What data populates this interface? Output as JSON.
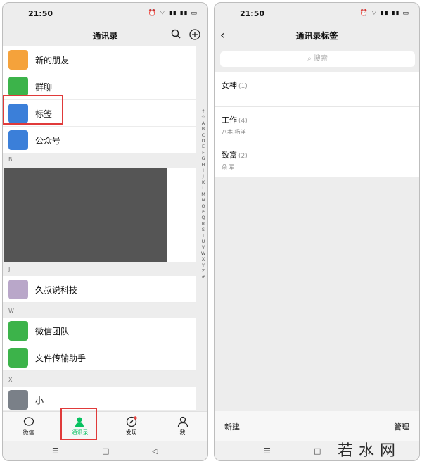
{
  "status": {
    "time": "21:50",
    "icons_text": "⏰ ⌔ ▮▮ ▮▮ ▭"
  },
  "left": {
    "title": "通讯录",
    "rows": [
      {
        "label": "新的朋友",
        "color": "#f5a23b"
      },
      {
        "label": "群聊",
        "color": "#3cb34a"
      },
      {
        "label": "标签",
        "color": "#3b7fd9"
      },
      {
        "label": "公众号",
        "color": "#3b7fd9"
      }
    ],
    "section_b": "B",
    "section_j": "J",
    "section_w": "W",
    "section_x": "X",
    "contact_j": "久叔说科技",
    "contact_w1": "微信团队",
    "contact_w2": "文件传输助手",
    "contact_x": "小",
    "alphabet": [
      "↑",
      "☆",
      "A",
      "B",
      "C",
      "D",
      "E",
      "F",
      "G",
      "H",
      "I",
      "J",
      "K",
      "L",
      "M",
      "N",
      "O",
      "P",
      "Q",
      "R",
      "S",
      "T",
      "U",
      "V",
      "W",
      "X",
      "Y",
      "Z",
      "#"
    ],
    "tabs": [
      {
        "label": "微信"
      },
      {
        "label": "通讯录",
        "active": true
      },
      {
        "label": "发现"
      },
      {
        "label": "我"
      }
    ],
    "accent": "#07c160"
  },
  "right": {
    "title": "通讯录标签",
    "search_placeholder": "搜索",
    "tags": [
      {
        "name": "女神",
        "count": "(1)",
        "members": ""
      },
      {
        "name": "工作",
        "count": "(4)",
        "members": "八本,杨洋"
      },
      {
        "name": "致富",
        "count": "(2)",
        "members": "朵 军"
      }
    ],
    "new_label": "新建",
    "manage_label": "管理"
  },
  "sysnav": {
    "menu": "☰",
    "home": "□",
    "back": "◁"
  },
  "watermark": "若水网"
}
